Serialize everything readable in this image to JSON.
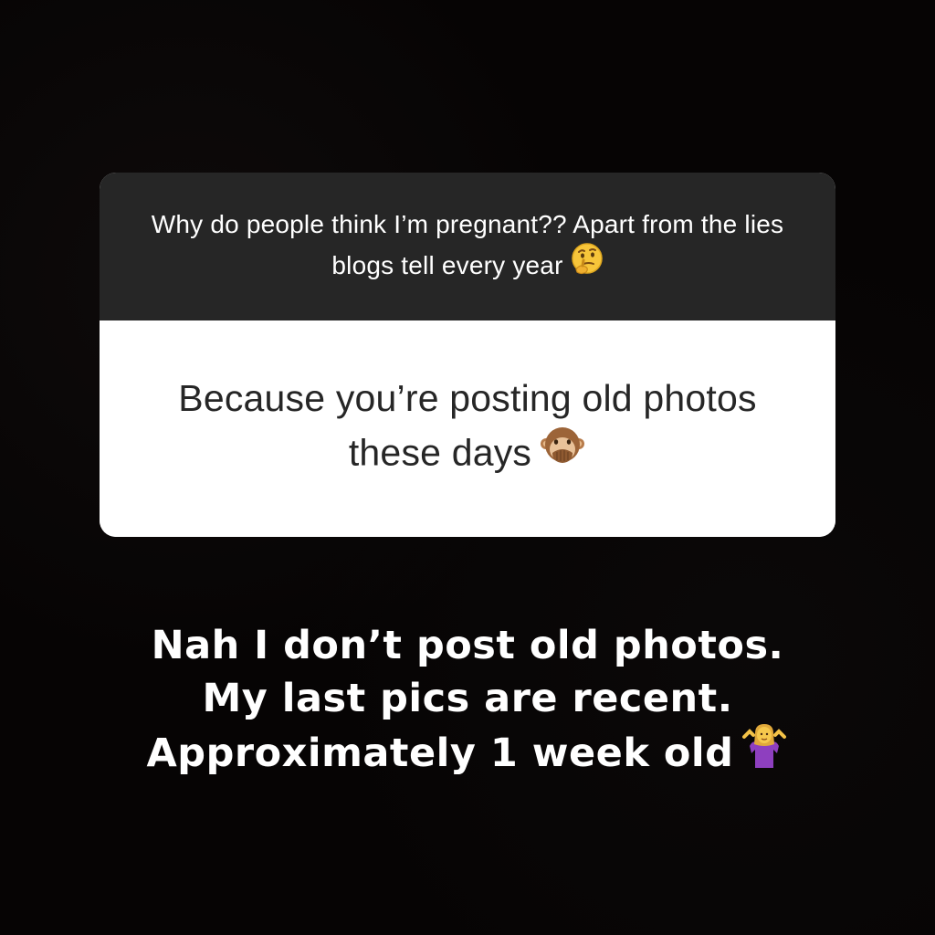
{
  "question": {
    "text": "Why do people think I’m pregnant?? Apart from the lies blogs tell every year",
    "emoji": "thinking-face-icon"
  },
  "answer": {
    "text": "Because you’re posting old photos these days",
    "emoji": "see-no-evil-monkey-icon"
  },
  "reply": {
    "text": "Nah I don’t post old photos. My last pics are recent. Approximately 1 week old",
    "emoji": "person-shrugging-icon"
  },
  "colors": {
    "background": "#060404",
    "question_bg": "#262626",
    "answer_bg": "#ffffff",
    "text_dark": "#262626",
    "text_light": "#ffffff"
  }
}
